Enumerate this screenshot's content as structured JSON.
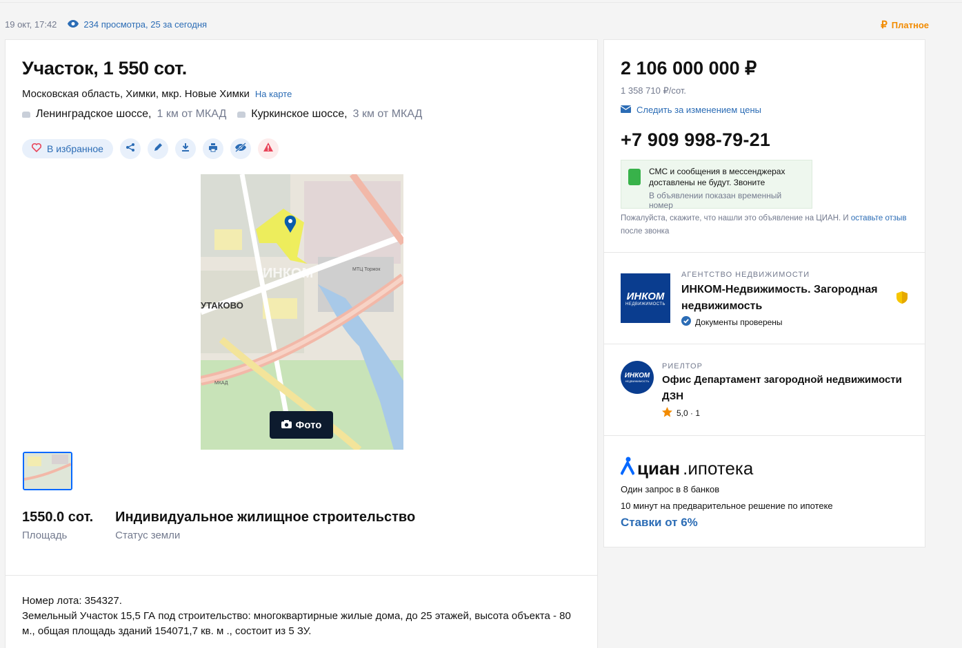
{
  "meta": {
    "date": "19 окт, 17:42",
    "views": "234 просмотра, 25 за сегодня",
    "paid": "Платное"
  },
  "listing": {
    "title": "Участок, 1 550 сот.",
    "address": "Московская область, Химки, мкр. Новые Химки",
    "map_link": "На карте",
    "highways": [
      {
        "name": "Ленинградское шоссе,",
        "distance": "1 км от МКАД"
      },
      {
        "name": "Куркинское шоссе,",
        "distance": "3 км от МКАД"
      }
    ],
    "favorite_label": "В избранное",
    "photo_label": "Фото",
    "map_labels": {
      "district": "УТАКОВО",
      "watermark": "ИНКОМ",
      "mall": "МТЦ Торжок",
      "road": "МКАД"
    },
    "facts": [
      {
        "value": "1550.0 сот.",
        "label": "Площадь"
      },
      {
        "value": "Индивидуальное жилищное строительство",
        "label": "Статус земли"
      }
    ],
    "description": [
      "Номер лота: 354327.",
      "Земельный Участок 15,5 ГА  под строительство: многоквартирные жилые дома, до 25 этажей, высота объекта  - 80 м., общая площадь зданий 154071,7 кв. м ., состоит из 5 ЗУ."
    ]
  },
  "sidebar": {
    "price": "2 106 000 000 ₽",
    "price_per_unit": "1 358 710 ₽/сот.",
    "follow_price": "Следить за изменением цены",
    "phone": "+7 909 998-79-21",
    "notice": {
      "main": "СМС и сообщения в мессенджерах доставлены не будут. Звоните",
      "sub": "В объявлении показан временный номер"
    },
    "ask": {
      "text1": "Пожалуйста, скажите, что нашли это объявление на ЦИАН. И ",
      "link": "оставьте отзыв",
      "text2": " после звонка"
    },
    "agency": {
      "role": "АГЕНТСТВО НЕДВИЖИМОСТИ",
      "name": "ИНКОМ-Недвижимость. Загородная недвижимость",
      "verified": "Документы проверены",
      "logo_text": "ИНКОМ",
      "logo_sub": "НЕДВИЖИМОСТЬ"
    },
    "realtor": {
      "role": "РИЕЛТОР",
      "name": "Офис Департамент загородной недвижимости ДЗН",
      "rating": "5,0 · 1",
      "logo_text": "ИНКОМ",
      "logo_sub": "НЕДВИЖИМОСТЬ"
    },
    "ipoteka": {
      "brand": "циан",
      "product": ".ипотека",
      "line1": "Один запрос в 8 банков",
      "line2": "10 минут на предварительное решение по ипотеке",
      "link": "Ставки от 6%"
    }
  },
  "colors": {
    "accent": "#2b6cb5",
    "paid": "#f28b00",
    "dark": "#0d1b2e",
    "logo": "#0a3d8f"
  }
}
